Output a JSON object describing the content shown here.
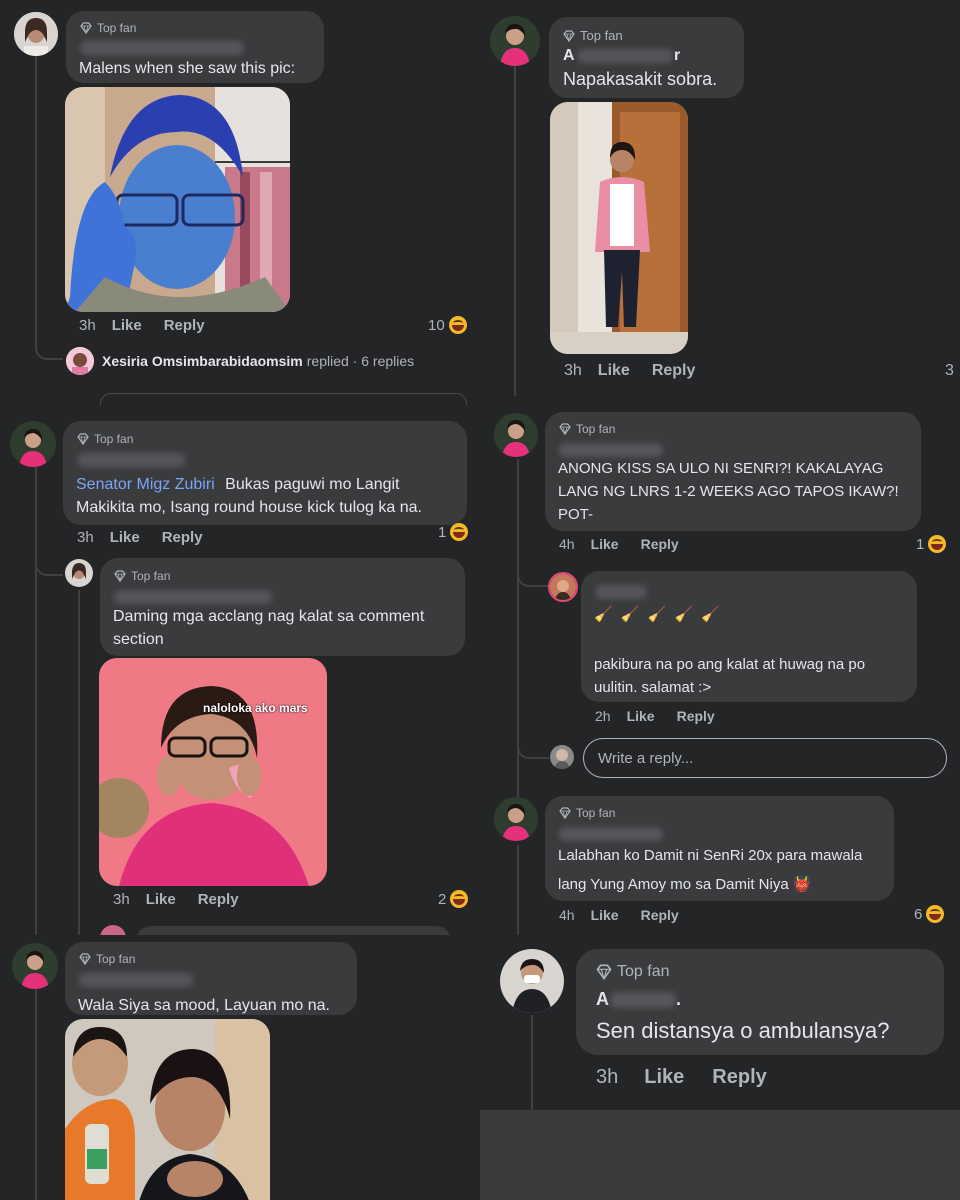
{
  "ui": {
    "top_fan": "Top fan",
    "like": "Like",
    "reply": "Reply",
    "write_reply_placeholder": "Write a reply..."
  },
  "panel1": {
    "comment_text": "Malens when she saw this pic:",
    "time": "3h",
    "reactions": "10",
    "replied_name": "Xesiria Omsimbarabidaomsim",
    "replied_suffix": "replied · 6 replies"
  },
  "panel2": {
    "name_partial_left": "A",
    "name_partial_right": "r",
    "comment_text": "Napakasakit sobra.",
    "time": "3h",
    "reactions": "3"
  },
  "panel3": {
    "comment1": {
      "mention": "Senator Migz Zubiri",
      "text_line1": "Bukas paguwi mo Langit",
      "text_line2": "Makikita mo, Isang round house kick tulog ka na.",
      "time": "3h",
      "reactions": "1"
    },
    "comment2": {
      "text_line1": "Daming mga acclang nag kalat sa comment",
      "text_line2": "section",
      "image_caption": "naloloka ako mars",
      "time": "3h",
      "reactions": "2"
    }
  },
  "panel4": {
    "comment1": {
      "text_line1": "ANONG KISS SA ULO NI SENRI?! KAKALAYAG",
      "text_line2": "LANG NG LNRS 1-2 WEEKS AGO TAPOS IKAW?!",
      "text_line3": "POT-",
      "time": "4h",
      "reactions": "1"
    },
    "reply1": {
      "brooms": "🧹 🧹 🧹 🧹 🧹",
      "text_line1": "pakibura na po ang kalat at huwag na po",
      "text_line2": "uulitin. salamat :>",
      "time": "2h"
    },
    "comment2": {
      "text_line1": "Lalabhan ko Damit ni SenRi 20x para mawala",
      "text_line2": "lang Yung Amoy mo sa Damit Niya",
      "emoji": "👹",
      "time": "4h",
      "reactions": "6"
    }
  },
  "panel5": {
    "comment_text": "Wala Siya sa mood, Layuan mo na."
  },
  "panel6": {
    "name_partial": "A",
    "name_dot": ".",
    "comment_text": "Sen distansya o ambulansya?",
    "time": "3h"
  },
  "colors": {
    "background": "#242526",
    "bubble": "#3a3b3c",
    "text": "#e4e6eb",
    "muted": "#b0b3b8",
    "link": "#7ba5f5",
    "gray_panel": "#3a3b3c"
  }
}
